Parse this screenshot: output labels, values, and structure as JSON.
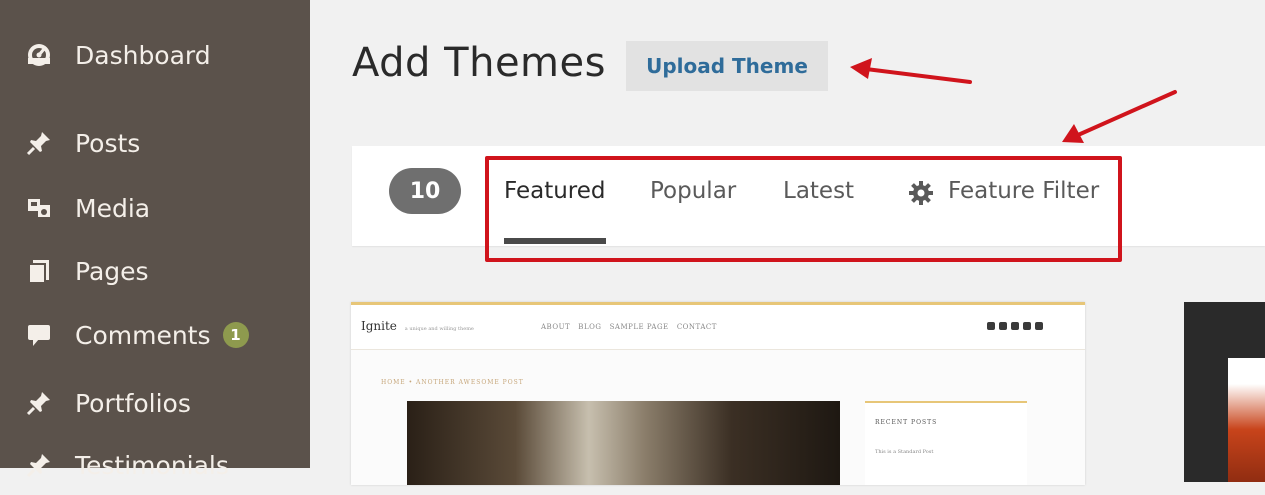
{
  "sidebar": {
    "items": [
      {
        "label": "Dashboard",
        "icon": "dashboard-icon"
      },
      {
        "label": "Posts",
        "icon": "pin-icon"
      },
      {
        "label": "Media",
        "icon": "media-icon"
      },
      {
        "label": "Pages",
        "icon": "pages-icon"
      },
      {
        "label": "Comments",
        "icon": "comment-bubble-icon",
        "badge": "1"
      },
      {
        "label": "Portfolios",
        "icon": "pin-icon"
      },
      {
        "label": "Testimonials",
        "icon": "pin-icon"
      }
    ]
  },
  "header": {
    "title": "Add Themes",
    "upload_label": "Upload Theme"
  },
  "filter": {
    "count": "10",
    "tabs": [
      "Featured",
      "Popular",
      "Latest"
    ],
    "active_tab": "Featured",
    "feature_filter_label": "Feature Filter"
  },
  "preview": {
    "logo": "Ignite",
    "tagline": "a unique and willing theme",
    "nav": "ABOUT   BLOG   SAMPLE PAGE   CONTACT",
    "breadcrumb": "HOME • ANOTHER AWESOME POST",
    "recent_posts": "RECENT POSTS",
    "recent_item": "This is a Standard Post"
  },
  "colors": {
    "sidebar_bg": "#5b524b",
    "annotation_red": "#d0141c",
    "link_blue": "#2f6c9a",
    "badge_green": "#8e9a4e"
  }
}
